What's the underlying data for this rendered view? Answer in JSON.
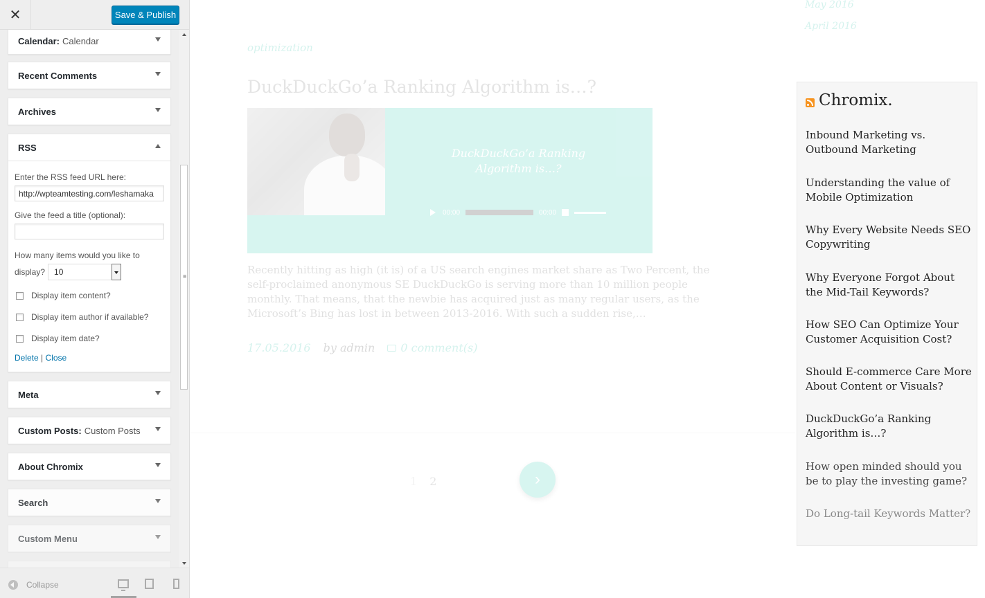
{
  "customizer": {
    "close_label": "✕",
    "save_label": "Save & Publish",
    "widgets": {
      "calendar": {
        "title": "Calendar:",
        "subtitle": "Calendar"
      },
      "recent_comments": {
        "title": "Recent Comments"
      },
      "archives": {
        "title": "Archives"
      },
      "rss": {
        "title": "RSS",
        "feed_url_label": "Enter the RSS feed URL here:",
        "feed_url_value": "http://wpteamtesting.com/leshamaka",
        "feed_title_label": "Give the feed a title (optional):",
        "feed_title_value": "",
        "items_label_line1": "How many items would you like to",
        "items_label_line2": "display?",
        "items_value": "10",
        "opt_content": "Display item content?",
        "opt_author": "Display item author if available?",
        "opt_date": "Display item date?",
        "delete_label": "Delete",
        "separator": "|",
        "close_label": "Close"
      },
      "meta": {
        "title": "Meta"
      },
      "custom_posts": {
        "title": "Custom Posts:",
        "subtitle": "Custom Posts"
      },
      "about": {
        "title": "About Chromix"
      },
      "search": {
        "title": "Search"
      },
      "custom_menu": {
        "title": "Custom Menu"
      }
    },
    "footer": {
      "collapse_label": "Collapse"
    }
  },
  "preview": {
    "archives": [
      "May 2016",
      "April 2016"
    ],
    "post": {
      "category": "optimization",
      "title": "DuckDuckGo’a Ranking Algorithm is…?",
      "audio_title": "DuckDuckGo’a Ranking Algorithm is…?",
      "audio_time_start": "00:00",
      "audio_time_end": "00:00",
      "excerpt": "Recently hitting as high (it is) of a US search engines market share as Two Percent, the self-proclaimed anonymous SE DuckDuckGo is serving more than 10 million people monthly. That means, that the newbie has acquired just as many regular users, as the Microsoft’s Bing has lost in between 2013-2016. With such a sudden rise,…",
      "date": "17.05.2016",
      "author": "by admin",
      "comments": "0 comment(s)"
    },
    "pagination": {
      "page1": "1",
      "page2": "2",
      "next_glyph": "›"
    },
    "rss_widget": {
      "title": "Chromix.",
      "items": [
        "Inbound Marketing vs. Outbound Marketing",
        "Understanding the value of Mobile Optimization",
        "Why Every Website Needs SEO Copywriting",
        "Why Everyone Forgot About the Mid-Tail Keywords?",
        "How SEO Can Optimize Your Customer Acquisition Cost?",
        "Should E-commerce Care More About Content or Visuals?",
        "DuckDuckGo’a Ranking Algorithm is…?",
        "How open minded should you be to play the investing game?",
        "Do Long-tail Keywords Matter?"
      ]
    }
  },
  "colors": {
    "accent": "#0085ba",
    "teal": "#4cd3bd",
    "rss_orange": "#f7931e"
  }
}
